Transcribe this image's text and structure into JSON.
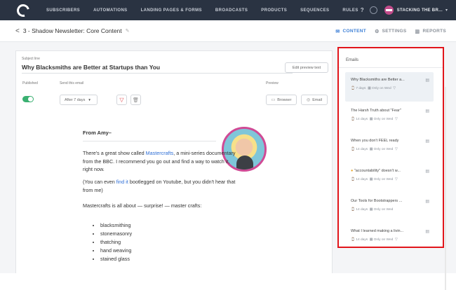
{
  "topnav": {
    "items": [
      "SUBSCRIBERS",
      "AUTOMATIONS",
      "LANDING PAGES & FORMS",
      "BROADCASTS",
      "PRODUCTS",
      "SEQUENCES",
      "RULES"
    ],
    "help": "?",
    "account": "STACKING THE BR..."
  },
  "subbar": {
    "back": "<",
    "title": "3 - Shadow Newsletter: Core Content",
    "tabs": [
      {
        "label": "CONTENT",
        "icon": "mail-icon"
      },
      {
        "label": "SETTINGS",
        "icon": "gear-icon"
      },
      {
        "label": "REPORTS",
        "icon": "bar-chart-icon"
      }
    ]
  },
  "editor": {
    "subject_label": "Subject line",
    "subject": "Why Blacksmiths are Better at Startups than You",
    "edit_preview_label": "Edit preview text",
    "published_label": "Published",
    "published": true,
    "send_label": "Send this email",
    "send_value": "After 7 days",
    "preview_label": "Preview",
    "browser_label": "Browser",
    "email_label": "Email"
  },
  "content": {
    "from": "From Amy–",
    "p1_a": "There's a great show called ",
    "p1_link": "Mastercrafts",
    "p1_b": ", a mini-series documentary from the BBC. I recommend you go out and find a way to watch it, right now.",
    "p2_a": "(You can even ",
    "p2_link": "find it",
    "p2_b": " bootlegged on Youtube, but you didn't hear that from me)",
    "p3": "Mastercrafts is all about — surprise! — master crafts:",
    "bullets": [
      "blacksmithing",
      "stonemasonry",
      "thatching",
      "hand weaving",
      "stained glass"
    ]
  },
  "emails_panel": {
    "title": "Emails",
    "items": [
      {
        "title": "Why Blacksmiths are Better a...",
        "days": "7 days",
        "schedule": "Only on Wed"
      },
      {
        "title": "The Harsh Truth about \"Fear\"",
        "days": "14 days",
        "schedule": "Only on Wed"
      },
      {
        "title": "When you don't FEEL ready",
        "days": "14 days",
        "schedule": "Only on Wed"
      },
      {
        "title": "\"accountability\" doesn't w...",
        "days": "14 days",
        "schedule": "Only on Wed"
      },
      {
        "title": "Our Tools for Bootstrappers ...",
        "days": "14 days",
        "schedule": "Only on Wed"
      },
      {
        "title": "What I learned making a livin...",
        "days": "14 days",
        "schedule": "Only on Wed"
      }
    ]
  },
  "colors": {
    "nav_bg": "#2a3342",
    "accent": "#3c7fd6",
    "toggle_on": "#3ab071",
    "highlight_border": "#e1151b",
    "avatar_ring": "#d04a95"
  }
}
